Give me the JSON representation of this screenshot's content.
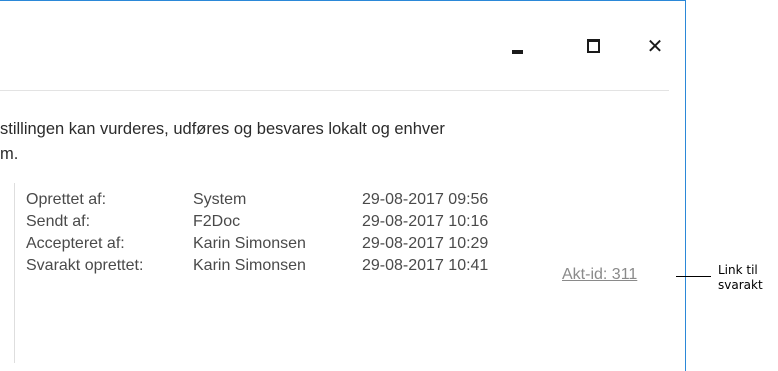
{
  "window": {
    "controls": {
      "minimize_icon": "minimize-icon",
      "maximize_icon": "maximize-icon",
      "close_icon": "close-icon",
      "close_glyph": "✕"
    },
    "border_color": "#2b88d8"
  },
  "description": {
    "lines": [
      "stillingen kan vurderes, udføres og besvares lokalt og enhver",
      "m."
    ]
  },
  "info": {
    "rows": [
      {
        "label": "Oprettet af:",
        "value": "System",
        "timestamp": "29-08-2017 09:56"
      },
      {
        "label": "Sendt af:",
        "value": "F2Doc",
        "timestamp": "29-08-2017 10:16"
      },
      {
        "label": "Accepteret af:",
        "value": "Karin Simonsen",
        "timestamp": "29-08-2017 10:29"
      },
      {
        "label": "Svarakt oprettet:",
        "value": "Karin Simonsen",
        "timestamp": "29-08-2017 10:41"
      }
    ],
    "akt_link": "Akt-id: 311"
  },
  "callout": {
    "lines": [
      "Link til",
      "svarakt"
    ]
  }
}
